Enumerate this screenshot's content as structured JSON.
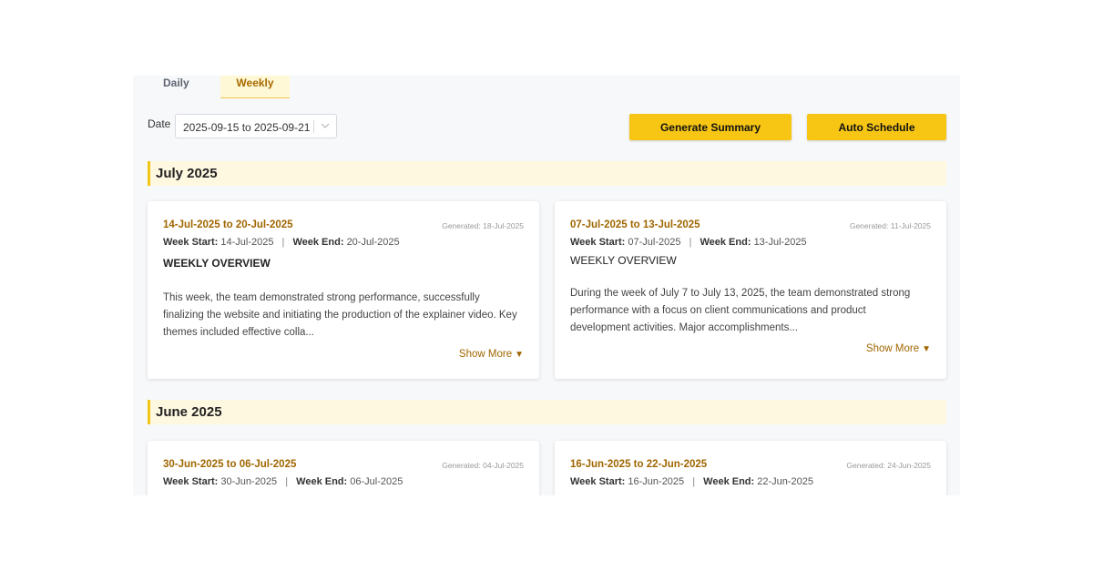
{
  "tabs": {
    "daily": "Daily",
    "weekly": "Weekly"
  },
  "filter": {
    "date_label": "Date",
    "date_value": "2025-09-15 to 2025-09-21"
  },
  "actions": {
    "generate_summary": "Generate Summary",
    "auto_schedule": "Auto Schedule"
  },
  "months": [
    {
      "title": "July 2025",
      "cards": [
        {
          "range": "14-Jul-2025 to 20-Jul-2025",
          "generated": "Generated: 18-Jul-2025",
          "week_start_label": "Week Start:",
          "week_start": "14-Jul-2025",
          "separator": "|",
          "week_end_label": "Week End:",
          "week_end": "20-Jul-2025",
          "heading": "WEEKLY OVERVIEW",
          "summary": "This week, the team demonstrated strong performance, successfully finalizing the website and initiating the production of the explainer video. Key themes included effective colla...",
          "show_more": "Show More"
        },
        {
          "range": "07-Jul-2025 to 13-Jul-2025",
          "generated": "Generated: 11-Jul-2025",
          "week_start_label": "Week Start:",
          "week_start": "07-Jul-2025",
          "separator": "|",
          "week_end_label": "Week End:",
          "week_end": "13-Jul-2025",
          "heading": "WEEKLY OVERVIEW",
          "summary": "During the week of July 7 to July 13, 2025, the team demonstrated strong performance with a focus on client communications and product development activities. Major accomplishments...",
          "show_more": "Show More"
        }
      ]
    },
    {
      "title": "June 2025",
      "cards": [
        {
          "range": "30-Jun-2025 to 06-Jul-2025",
          "generated": "Generated: 04-Jul-2025",
          "week_start_label": "Week Start:",
          "week_start": "30-Jun-2025",
          "separator": "|",
          "week_end_label": "Week End:",
          "week_end": "06-Jul-2025"
        },
        {
          "range": "16-Jun-2025 to 22-Jun-2025",
          "generated": "Generated: 24-Jun-2025",
          "week_start_label": "Week Start:",
          "week_start": "16-Jun-2025",
          "separator": "|",
          "week_end_label": "Week End:",
          "week_end": "22-Jun-2025"
        }
      ]
    }
  ],
  "colors": {
    "accent": "#f7c614",
    "link": "#a06600",
    "month_band": "#fff8e1"
  }
}
